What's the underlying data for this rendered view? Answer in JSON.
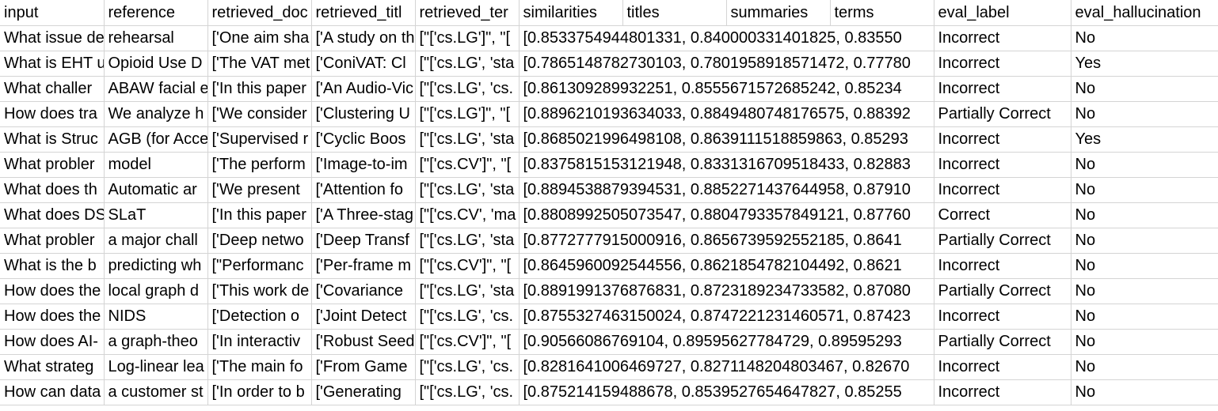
{
  "columns": [
    "input",
    "reference",
    "retrieved_doc",
    "retrieved_titl",
    "retrieved_ter",
    "similarities",
    "titles",
    "summaries",
    "terms",
    "eval_label",
    "eval_hallucination"
  ],
  "rows": [
    {
      "input": "What issue de",
      "reference": "rehearsal",
      "retrieved_docs": "['One aim sha",
      "retrieved_titles": "['A study on th",
      "retrieved_terms": "[\"['cs.LG']\", \"[",
      "similarities": "[0.8533754944801331, 0.840000331401825, 0.83550",
      "eval_label": "Incorrect",
      "eval_hallucination": "No"
    },
    {
      "input": "What is EHT u",
      "reference": "Opioid Use D",
      "retrieved_docs": "['The VAT met",
      "retrieved_titles": "['ConiVAT: Cl",
      "retrieved_terms": "[\"['cs.LG', 'sta",
      "similarities": "[0.7865148782730103, 0.7801958918571472, 0.77780",
      "eval_label": "Incorrect",
      "eval_hallucination": "Yes"
    },
    {
      "input": "What challer",
      "reference": "ABAW facial e",
      "retrieved_docs": "['In this paper",
      "retrieved_titles": "['An Audio-Vic",
      "retrieved_terms": "[\"['cs.LG', 'cs.",
      "similarities": "[0.861309289932251, 0.8555671572685242, 0.85234",
      "eval_label": "Incorrect",
      "eval_hallucination": "No"
    },
    {
      "input": "How does tra",
      "reference": "We analyze h",
      "retrieved_docs": "['We consider",
      "retrieved_titles": "['Clustering U",
      "retrieved_terms": "[\"['cs.LG']\", \"[",
      "similarities": "[0.8896210193634033, 0.8849480748176575, 0.88392",
      "eval_label": "Partially Correct",
      "eval_hallucination": "No"
    },
    {
      "input": "What is Struc",
      "reference": "AGB (for Acce",
      "retrieved_docs": "['Supervised r",
      "retrieved_titles": "['Cyclic Boos",
      "retrieved_terms": "[\"['cs.LG', 'sta",
      "similarities": "[0.8685021996498108, 0.8639111518859863, 0.85293",
      "eval_label": "Incorrect",
      "eval_hallucination": "Yes"
    },
    {
      "input": "What probler",
      "reference": "model",
      "retrieved_docs": "['The perform",
      "retrieved_titles": "['Image-to-im",
      "retrieved_terms": "[\"['cs.CV']\", \"[",
      "similarities": "[0.8375815153121948, 0.8331316709518433, 0.82883",
      "eval_label": "Incorrect",
      "eval_hallucination": "No"
    },
    {
      "input": "What does th",
      "reference": "Automatic ar",
      "retrieved_docs": "['We present",
      "retrieved_titles": "['Attention fo",
      "retrieved_terms": "[\"['cs.LG', 'sta",
      "similarities": "[0.8894538879394531, 0.8852271437644958, 0.87910",
      "eval_label": "Incorrect",
      "eval_hallucination": "No"
    },
    {
      "input": "What does DS",
      "reference": "SLaT",
      "retrieved_docs": "['In this paper",
      "retrieved_titles": "['A Three-stag",
      "retrieved_terms": "[\"['cs.CV', 'ma",
      "similarities": "[0.8808992505073547, 0.8804793357849121, 0.87760",
      "eval_label": "Correct",
      "eval_hallucination": "No"
    },
    {
      "input": "What probler",
      "reference": "a major chall",
      "retrieved_docs": "['Deep netwo",
      "retrieved_titles": "['Deep Transf",
      "retrieved_terms": "[\"['cs.LG', 'sta",
      "similarities": "[0.8772777915000916, 0.8656739592552185, 0.8641",
      "eval_label": "Partially Correct",
      "eval_hallucination": "No"
    },
    {
      "input": "What is the b",
      "reference": "predicting wh",
      "retrieved_docs": "[\"Performanc",
      "retrieved_titles": "['Per-frame m",
      "retrieved_terms": "[\"['cs.CV']\", \"[",
      "similarities": "[0.8645960092544556, 0.8621854782104492, 0.8621",
      "eval_label": "Incorrect",
      "eval_hallucination": "No"
    },
    {
      "input": "How does the",
      "reference": "local graph d",
      "retrieved_docs": "['This work de",
      "retrieved_titles": "['Covariance",
      "retrieved_terms": "[\"['cs.LG', 'sta",
      "similarities": "[0.8891991376876831, 0.8723189234733582, 0.87080",
      "eval_label": "Partially Correct",
      "eval_hallucination": "No"
    },
    {
      "input": "How does the",
      "reference": "NIDS",
      "retrieved_docs": "['Detection o",
      "retrieved_titles": "['Joint Detect",
      "retrieved_terms": "[\"['cs.LG', 'cs.",
      "similarities": "[0.8755327463150024, 0.8747221231460571, 0.87423",
      "eval_label": "Incorrect",
      "eval_hallucination": "No"
    },
    {
      "input": "How does AI-",
      "reference": "a graph-theo",
      "retrieved_docs": "['In interactiv",
      "retrieved_titles": "['Robust Seed",
      "retrieved_terms": "[\"['cs.CV']\", \"[",
      "similarities": "[0.90566086769104, 0.89595627784729, 0.89595293",
      "eval_label": "Partially Correct",
      "eval_hallucination": "No"
    },
    {
      "input": "What strateg",
      "reference": "Log-linear lea",
      "retrieved_docs": "['The main fo",
      "retrieved_titles": "['From Game",
      "retrieved_terms": "[\"['cs.LG', 'cs.",
      "similarities": "[0.8281641006469727, 0.8271148204803467, 0.82670",
      "eval_label": "Incorrect",
      "eval_hallucination": "No"
    },
    {
      "input": "How can data",
      "reference": "a customer st",
      "retrieved_docs": "['In order to b",
      "retrieved_titles": "['Generating",
      "retrieved_terms": "[\"['cs.LG', 'cs.",
      "similarities": "[0.875214159488678, 0.8539527654647827, 0.85255",
      "eval_label": "Incorrect",
      "eval_hallucination": "No"
    }
  ]
}
